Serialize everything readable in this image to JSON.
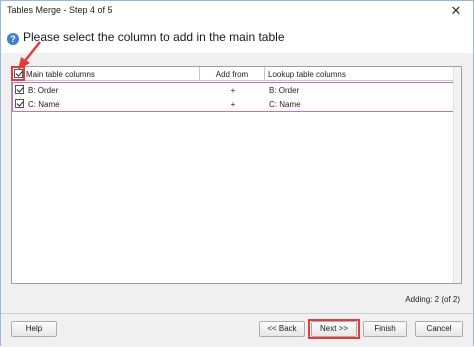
{
  "window": {
    "title": "Tables Merge - Step 4 of 5",
    "close_glyph": "✕"
  },
  "header": {
    "prompt": "Please select the column to add in the main table",
    "help_glyph": "?"
  },
  "grid": {
    "columns": {
      "main": "Main table columns",
      "add": "Add from",
      "lookup": "Lookup table columns"
    },
    "select_all_checked": true,
    "rows": [
      {
        "checked": true,
        "main": "B: Order",
        "add": "+",
        "lookup": "B: Order"
      },
      {
        "checked": true,
        "main": "C: Name",
        "add": "+",
        "lookup": "C: Name"
      }
    ]
  },
  "status": {
    "adding": "Adding: 2 (of 2)"
  },
  "buttons": {
    "help": "Help",
    "back": "<< Back",
    "next": "Next >>",
    "finish": "Finish",
    "cancel": "Cancel"
  },
  "colors": {
    "highlight": "#e23b3b",
    "row_box": "#c86ec8",
    "accent": "#3b7fd0"
  },
  "icons": {
    "help": "help-icon",
    "close": "close-icon",
    "checkbox": "checkbox-checked-icon"
  }
}
